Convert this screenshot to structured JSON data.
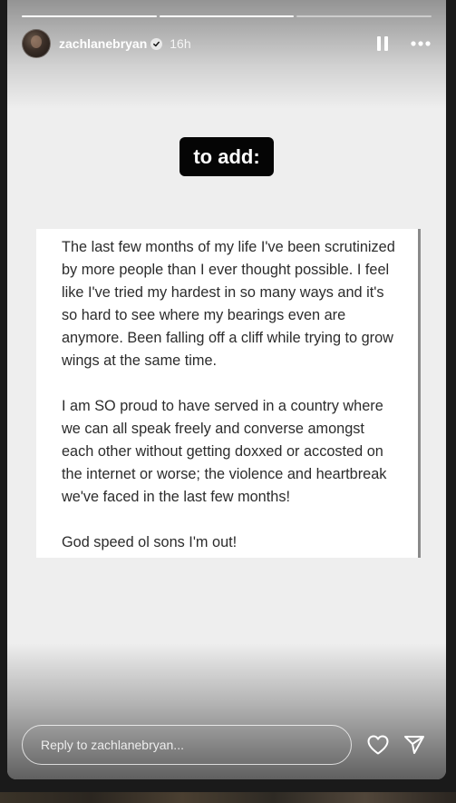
{
  "story": {
    "progress_total": 3,
    "progress_done": 2,
    "header": {
      "username": "zachlanebryan",
      "time": "16h"
    },
    "sticker": {
      "text": "to add:"
    },
    "note": {
      "paragraphs": [
        "The last few months of my life I've been scrutinized by more people than I ever thought possible. I feel like I've tried my hardest in so many ways and it's so hard to see where my bearings even are anymore. Been falling off a cliff while trying to grow wings at the same time.",
        "I am SO proud to have served in a country where we can all speak freely and converse amongst each other without getting doxxed or accosted on the internet or worse; the violence and heartbreak we've faced in the last few months!",
        "God speed ol sons I'm out!"
      ]
    },
    "reply": {
      "placeholder": "Reply to zachlanebryan..."
    }
  },
  "icons": {
    "verified": "verified-badge-icon",
    "pause": "pause-icon",
    "more": "more-icon",
    "heart": "heart-icon",
    "send": "send-icon"
  },
  "colors": {
    "background": "#eeeeee",
    "sticker": "#050505",
    "note_card": "#ffffff",
    "text": "#2c2c2c"
  }
}
